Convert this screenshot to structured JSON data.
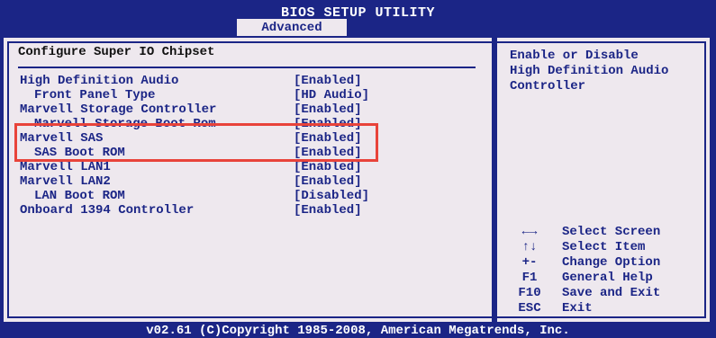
{
  "header": {
    "title": "BIOS SETUP UTILITY",
    "active_tab": "Advanced"
  },
  "main": {
    "section_title": "Configure Super IO Chipset",
    "items": [
      {
        "label": "High Definition Audio",
        "value": "[Enabled]",
        "sub": false
      },
      {
        "label": "Front Panel Type",
        "value": "[HD Audio]",
        "sub": true
      },
      {
        "label": "Marvell Storage Controller",
        "value": "[Enabled]",
        "sub": false
      },
      {
        "label": "Marvell Storage Boot Rom",
        "value": "[Enabled]",
        "sub": true
      },
      {
        "label": "Marvell SAS",
        "value": "[Enabled]",
        "sub": false
      },
      {
        "label": "SAS Boot ROM",
        "value": "[Enabled]",
        "sub": true
      },
      {
        "label": "Marvell LAN1",
        "value": "[Enabled]",
        "sub": false
      },
      {
        "label": "Marvell LAN2",
        "value": "[Enabled]",
        "sub": false
      },
      {
        "label": "LAN Boot ROM",
        "value": "[Disabled]",
        "sub": true
      },
      {
        "label": "Onboard 1394 Controller",
        "value": "[Enabled]",
        "sub": false
      }
    ]
  },
  "help": {
    "text_line1": "Enable or Disable",
    "text_line2": "High Definition Audio",
    "text_line3": "Controller",
    "keys": [
      {
        "key": "←→",
        "desc": "Select Screen"
      },
      {
        "key": "↑↓",
        "desc": "Select Item"
      },
      {
        "key": "+-",
        "desc": "Change Option"
      },
      {
        "key": "F1",
        "desc": "General Help"
      },
      {
        "key": "F10",
        "desc": "Save and Exit"
      },
      {
        "key": "ESC",
        "desc": "Exit"
      }
    ]
  },
  "footer": {
    "text": "v02.61 (C)Copyright 1985-2008, American Megatrends, Inc."
  },
  "colors": {
    "bios_blue": "#1b2586",
    "panel_gray": "#eee8ee",
    "highlight_red": "#e8433a"
  }
}
